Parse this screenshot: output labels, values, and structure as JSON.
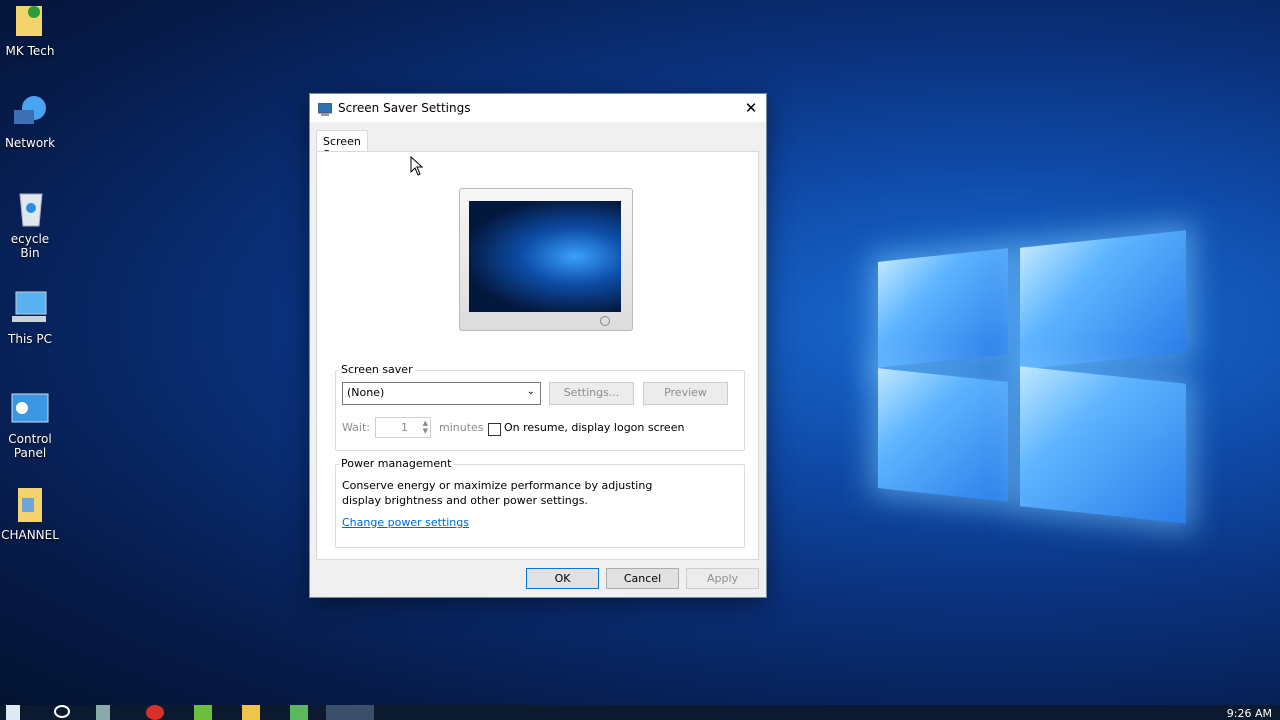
{
  "desktop": {
    "icons": [
      {
        "label": "MK Tech",
        "icon": "folder-user-icon"
      },
      {
        "label": "Network",
        "icon": "network-icon"
      },
      {
        "label": "ecycle Bin",
        "icon": "recycle-bin-icon"
      },
      {
        "label": "This PC",
        "icon": "this-pc-icon"
      },
      {
        "label": "Control Panel",
        "icon": "control-panel-icon"
      },
      {
        "label": "CHANNEL",
        "icon": "folder-icon"
      }
    ]
  },
  "dialog": {
    "title": "Screen Saver Settings",
    "close": "✕",
    "tab": "Screen Saver",
    "screen_saver": {
      "group_label": "Screen saver",
      "selected": "(None)",
      "settings_button": "Settings...",
      "preview_button": "Preview",
      "wait_label": "Wait:",
      "wait_value": "1",
      "minutes_label": "minutes",
      "logon_checkbox": "On resume, display logon screen"
    },
    "power": {
      "group_label": "Power management",
      "description": "Conserve energy or maximize performance by adjusting display brightness and other power settings.",
      "link": "Change power settings"
    },
    "buttons": {
      "ok": "OK",
      "cancel": "Cancel",
      "apply": "Apply"
    }
  },
  "taskbar": {
    "time": "9:26 AM"
  }
}
